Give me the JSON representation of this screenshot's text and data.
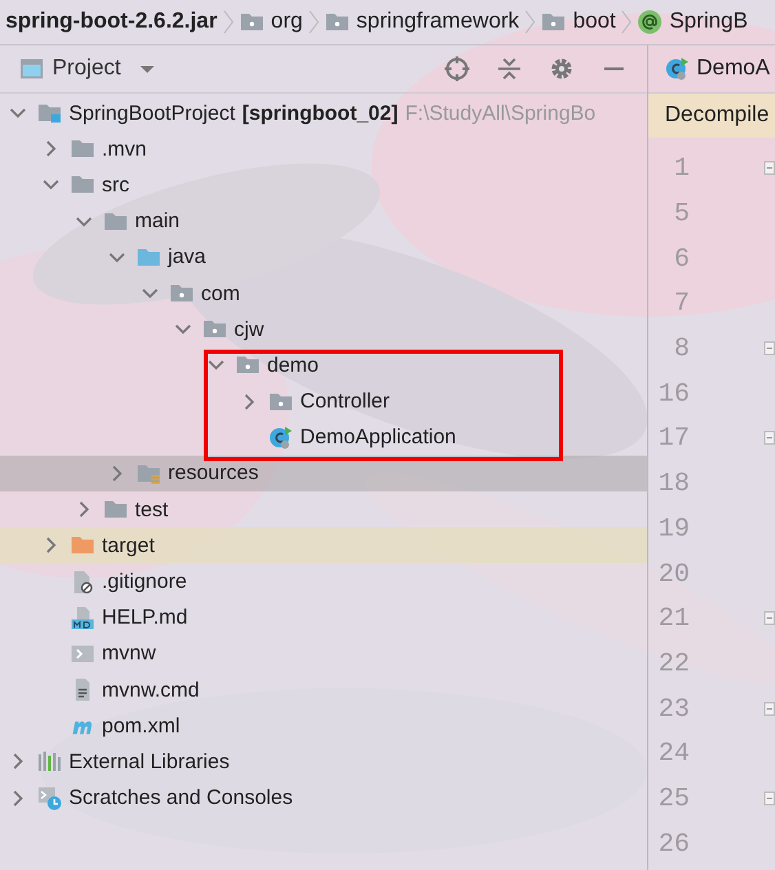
{
  "breadcrumbs": [
    {
      "label": "spring-boot-2.6.2.jar",
      "kind": "jar"
    },
    {
      "label": "org",
      "kind": "package"
    },
    {
      "label": "springframework",
      "kind": "package"
    },
    {
      "label": "boot",
      "kind": "package"
    },
    {
      "label": "SpringB",
      "kind": "annotation"
    }
  ],
  "project_panel": {
    "title": "Project",
    "tree": [
      {
        "label": "SpringBootProject",
        "module": "[springboot_02]",
        "path": "F:\\StudyAll\\SpringBo",
        "kind": "module",
        "expanded": true,
        "selected": false,
        "children": [
          {
            "label": ".mvn",
            "kind": "folder",
            "expanded": false,
            "selected": false
          },
          {
            "label": "src",
            "kind": "folder",
            "expanded": true,
            "selected": false,
            "children": [
              {
                "label": "main",
                "kind": "folder",
                "expanded": true,
                "selected": false,
                "children": [
                  {
                    "label": "java",
                    "kind": "source-folder",
                    "expanded": true,
                    "selected": false,
                    "children": [
                      {
                        "label": "com",
                        "kind": "package",
                        "expanded": true,
                        "selected": false,
                        "children": [
                          {
                            "label": "cjw",
                            "kind": "package",
                            "expanded": true,
                            "selected": false,
                            "children": [
                              {
                                "label": "demo",
                                "kind": "package",
                                "expanded": true,
                                "selected": false,
                                "children": [
                                  {
                                    "label": "Controller",
                                    "kind": "package",
                                    "expanded": false,
                                    "selected": false
                                  },
                                  {
                                    "label": "DemoApplication",
                                    "kind": "class",
                                    "selected": false
                                  }
                                ]
                              }
                            ]
                          }
                        ]
                      }
                    ]
                  },
                  {
                    "label": "resources",
                    "kind": "resource-folder",
                    "expanded": false,
                    "selected": true
                  }
                ]
              },
              {
                "label": "test",
                "kind": "folder",
                "expanded": false,
                "selected": false
              }
            ]
          },
          {
            "label": "target",
            "kind": "excluded-folder",
            "expanded": false,
            "selected": false
          },
          {
            "label": ".gitignore",
            "kind": "ignore-file",
            "selected": false
          },
          {
            "label": "HELP.md",
            "kind": "markdown-file",
            "selected": false
          },
          {
            "label": "mvnw",
            "kind": "script-file",
            "selected": false
          },
          {
            "label": "mvnw.cmd",
            "kind": "text-file",
            "selected": false
          },
          {
            "label": "pom.xml",
            "kind": "maven-file",
            "selected": false
          }
        ]
      },
      {
        "label": "External Libraries",
        "kind": "libraries",
        "expanded": false,
        "selected": false
      },
      {
        "label": "Scratches and Consoles",
        "kind": "scratches",
        "expanded": false,
        "selected": false
      }
    ]
  },
  "editor": {
    "tab": "DemoA",
    "banner": "Decompile",
    "lines": [
      {
        "number": "1",
        "fold": true
      },
      {
        "number": "5",
        "fold": false
      },
      {
        "number": "6",
        "fold": false
      },
      {
        "number": "7",
        "fold": false
      },
      {
        "number": "8",
        "fold": true
      },
      {
        "number": "16",
        "fold": false
      },
      {
        "number": "17",
        "fold": true
      },
      {
        "number": "18",
        "fold": false
      },
      {
        "number": "19",
        "fold": false
      },
      {
        "number": "20",
        "fold": false
      },
      {
        "number": "21",
        "fold": true
      },
      {
        "number": "22",
        "fold": false
      },
      {
        "number": "23",
        "fold": true
      },
      {
        "number": "24",
        "fold": false
      },
      {
        "number": "25",
        "fold": true
      },
      {
        "number": "26",
        "fold": false
      }
    ]
  }
}
